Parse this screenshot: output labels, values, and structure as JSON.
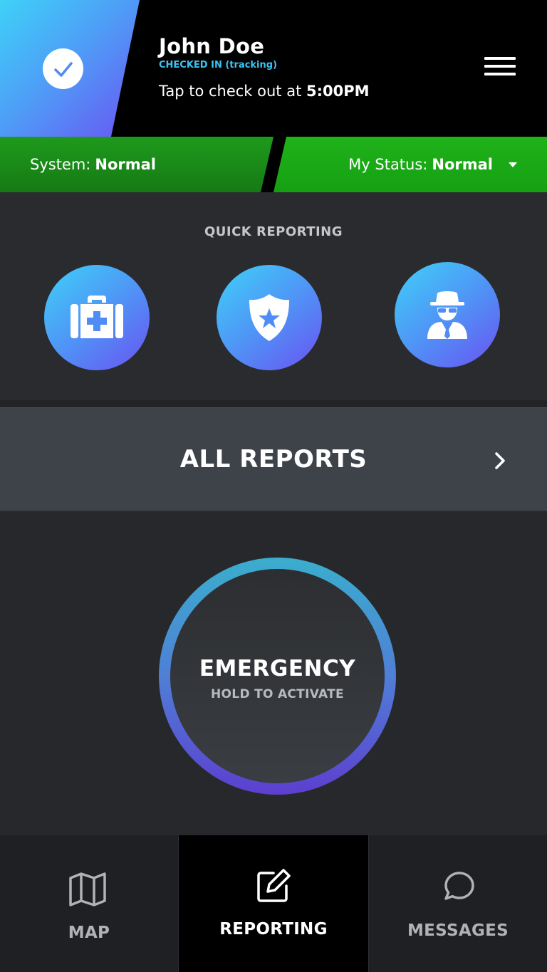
{
  "header": {
    "user_name": "John Doe",
    "checkin_state": "CHECKED IN (tracking)",
    "checkout_prefix": "Tap to check out at",
    "checkout_time": "5:00PM",
    "check_icon": "check-icon",
    "menu_icon": "hamburger-menu-icon"
  },
  "status_bar": {
    "system_label": "System:",
    "system_value": "Normal",
    "my_status_label": "My Status:",
    "my_status_value": "Normal",
    "status_color": "#1fb21a"
  },
  "quick_reporting": {
    "title": "QUICK REPORTING",
    "buttons": [
      {
        "icon": "medical-kit-icon"
      },
      {
        "icon": "police-badge-icon"
      },
      {
        "icon": "suspicious-person-icon"
      }
    ]
  },
  "all_reports": {
    "label": "ALL REPORTS",
    "icon": "chevron-right-icon"
  },
  "emergency": {
    "title": "EMERGENCY",
    "subtitle": "HOLD TO ACTIVATE"
  },
  "bottom_nav": {
    "tabs": [
      {
        "label": "MAP",
        "icon": "map-icon",
        "active": false
      },
      {
        "label": "REPORTING",
        "icon": "edit-icon",
        "active": true
      },
      {
        "label": "MESSAGES",
        "icon": "chat-bubble-icon",
        "active": false
      }
    ]
  },
  "colors": {
    "accent_gradient_start": "#3fd1f8",
    "accent_gradient_end": "#6a52f2",
    "checkin_text": "#39c4f4"
  }
}
